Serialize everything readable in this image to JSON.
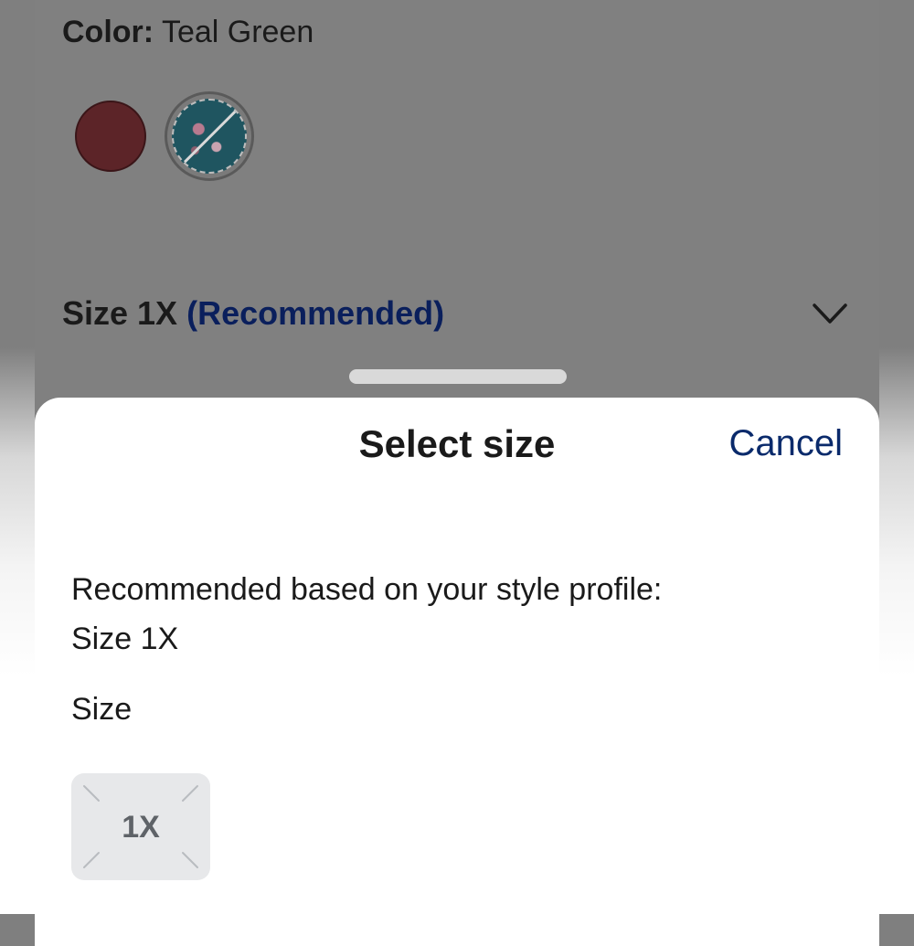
{
  "product": {
    "color_label": "Color:",
    "color_value": "Teal Green",
    "swatches": [
      {
        "name": "burgundy",
        "color": "#5c2428"
      },
      {
        "name": "teal-floral",
        "color": "#1f5560",
        "unavailable": true
      }
    ],
    "size_label": "Size 1X",
    "size_recommended": "(Recommended)",
    "dropdown_icon": "chevron-down-icon"
  },
  "sheet": {
    "title": "Select size",
    "cancel_label": "Cancel",
    "recommendation_line1": "Recommended based on your style profile:",
    "recommendation_line2": "Size 1X",
    "size_heading": "Size",
    "options": [
      {
        "label": "1X",
        "unavailable": true
      }
    ]
  },
  "colors": {
    "accent": "#0a2a6b",
    "overlay": "#808080",
    "option_bg": "#e7e8ea"
  }
}
